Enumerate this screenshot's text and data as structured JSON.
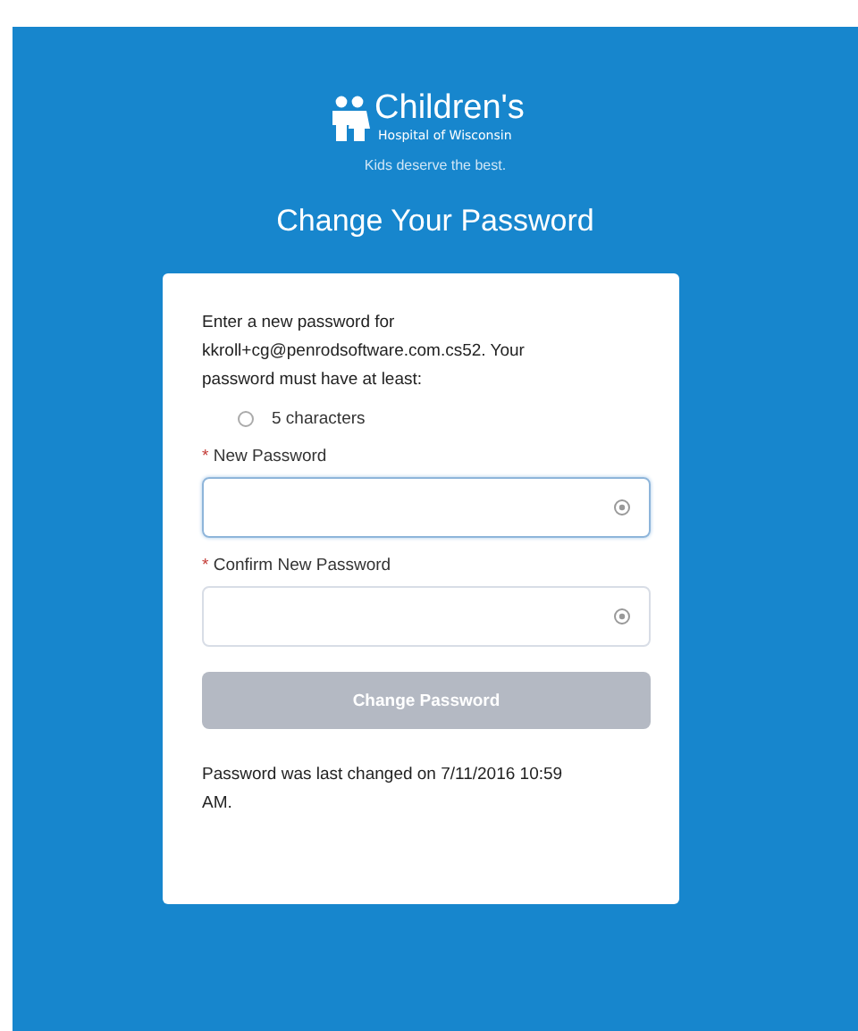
{
  "logo": {
    "name": "Children's",
    "subtitle": "Hospital of Wisconsin",
    "tagline": "Kids deserve the best."
  },
  "title": "Change Your Password",
  "intro": "Enter a new password for kkroll+cg@penrodsoftware.com.cs52. Your password must have at least:",
  "requirements": [
    {
      "label": "5 characters",
      "met": false
    }
  ],
  "fields": [
    {
      "label": "New Password",
      "required_mark": "*",
      "focused": true
    },
    {
      "label": "Confirm New Password",
      "required_mark": "*",
      "focused": false
    }
  ],
  "submit": {
    "label": "Change Password",
    "disabled": true
  },
  "footer": "Password was last changed on 7/11/2016 10:59 AM."
}
